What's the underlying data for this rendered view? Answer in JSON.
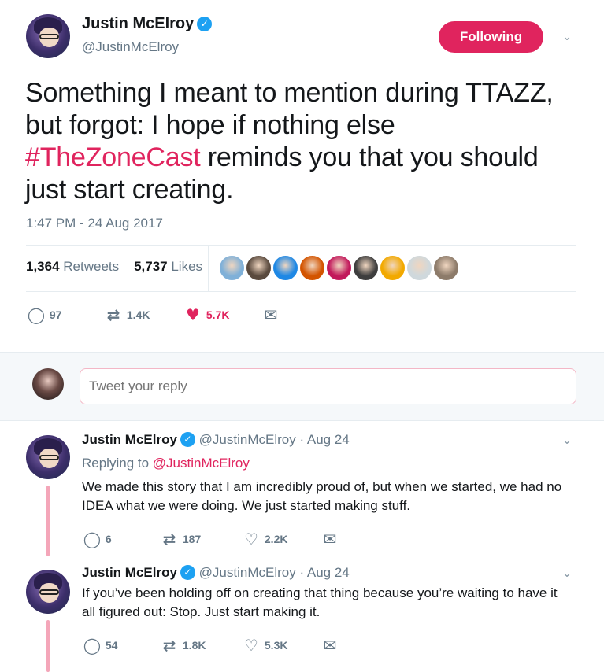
{
  "main": {
    "author_name": "Justin McElroy",
    "verified_glyph": "✓",
    "handle": "@JustinMcElroy",
    "follow_label": "Following",
    "text_part1": "Something I meant to mention during TTAZZ, but forgot: I hope if nothing else ",
    "hashtag": "#TheZoneCast",
    "text_part2": " reminds you that you should just start creating.",
    "timestamp": "1:47 PM - 24 Aug 2017",
    "retweets_count": "1,364",
    "retweets_label": "Retweets",
    "likes_count": "5,737",
    "likes_label": "Likes",
    "liker_colors": [
      "#7fb0d8",
      "#5a4a3e",
      "#1e88e5",
      "#d35400",
      "#c2185b",
      "#3e3e3e",
      "#f2a900",
      "#cfd8dc",
      "#8d7b6a"
    ],
    "actions": {
      "reply_count": "97",
      "retweet_count": "1.4K",
      "like_count": "5.7K"
    }
  },
  "reply_box": {
    "placeholder": "Tweet your reply"
  },
  "thread": [
    {
      "author_name": "Justin McElroy",
      "handle_date": "@JustinMcElroy · Aug 24",
      "replying_prefix": "Replying to ",
      "replying_mention": "@JustinMcElroy",
      "text": "We made this story that I am incredibly proud of, but when we started, we had no IDEA what we were doing. We just started making stuff.",
      "reply_count": "6",
      "retweet_count": "187",
      "like_count": "2.2K"
    },
    {
      "author_name": "Justin McElroy",
      "handle_date": "@JustinMcElroy · Aug 24",
      "text": "If you’ve been holding off on creating that thing because you’re waiting to have it all figured out: Stop. Just start making it.",
      "reply_count": "54",
      "retweet_count": "1.8K",
      "like_count": "5.3K"
    }
  ],
  "icons": {
    "caret": "chevron-down-icon",
    "reply": "reply-icon",
    "retweet": "retweet-icon",
    "like": "heart-icon",
    "dm": "mail-icon",
    "verified": "verified-badge-icon"
  },
  "colors": {
    "accent": "#e0245e",
    "verified": "#1da1f2",
    "muted": "#657786",
    "thread_line": "#f4a6b9"
  }
}
